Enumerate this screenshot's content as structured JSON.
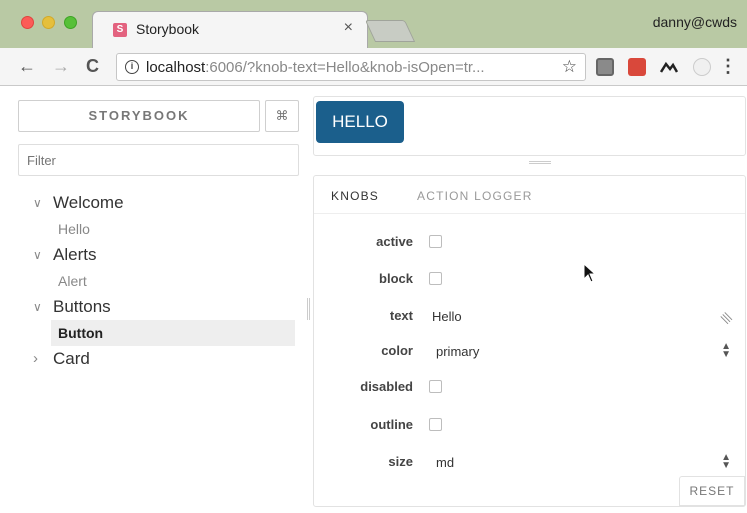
{
  "browser": {
    "tab_title": "Storybook",
    "tab_close": "×",
    "profile": "danny@cwds",
    "url_host": "localhost",
    "url_rest": ":6006/?knob-text=Hello&knob-isOpen=tr...",
    "nav_back": "←",
    "nav_forward": "→",
    "nav_reload": "C",
    "info_glyph": "i",
    "star_glyph": "☆",
    "menu_glyph": "⋮",
    "favicon_letter": "S"
  },
  "sidebar": {
    "brand": "STORYBOOK",
    "shortcut": "⌘",
    "filter_placeholder": "Filter",
    "kinds": [
      {
        "label": "Welcome",
        "chevron": "∨",
        "stories": [
          "Hello"
        ]
      },
      {
        "label": "Alerts",
        "chevron": "∨",
        "stories": [
          "Alert"
        ]
      },
      {
        "label": "Buttons",
        "chevron": "∨",
        "stories": [
          "Button"
        ]
      },
      {
        "label": "Card",
        "chevron": "›",
        "stories": []
      }
    ],
    "selected_story": "Button"
  },
  "preview": {
    "button_label": "HELLO"
  },
  "addons": {
    "tabs": [
      "KNOBS",
      "ACTION LOGGER"
    ],
    "active_tab": "KNOBS",
    "knobs": {
      "active": "active",
      "block": "block",
      "text": "text",
      "text_value": "Hello",
      "color": "color",
      "color_value": "primary",
      "disabled": "disabled",
      "outline": "outline",
      "size": "size",
      "size_value": "md"
    },
    "reset_label": "RESET"
  },
  "colors": {
    "titlebar": "#b9c9a4",
    "primary_button": "#1b5f8c"
  },
  "icons": [
    "info-icon",
    "star-icon",
    "extension-icons",
    "menu-icon",
    "mouse-cursor-icon"
  ]
}
